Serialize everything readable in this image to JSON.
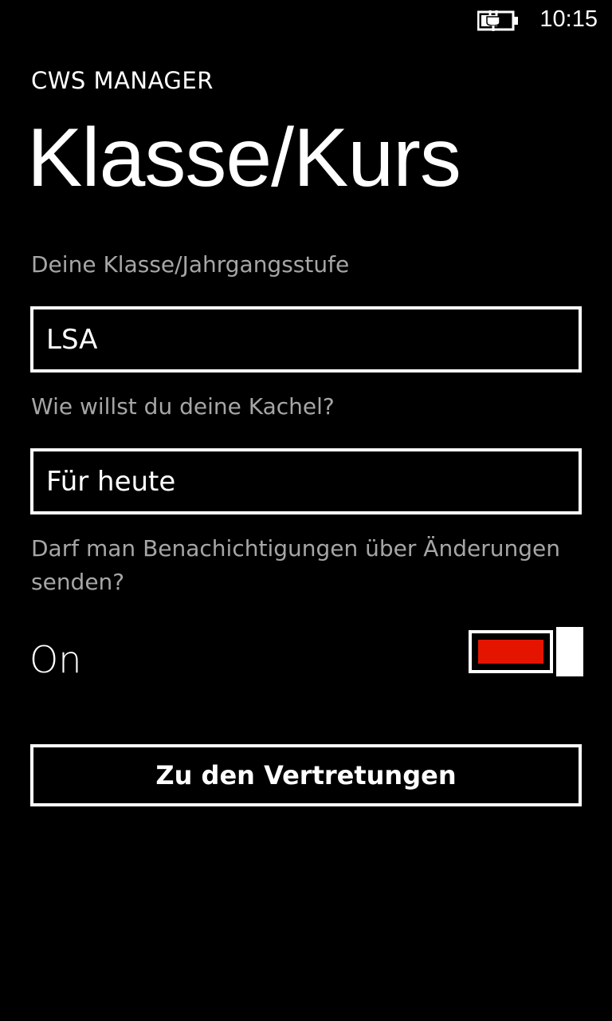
{
  "status_bar": {
    "time": "10:15",
    "battery_icon": "battery-charging-icon"
  },
  "app": {
    "name": "CWS MANAGER",
    "page_title": "Klasse/Kurs"
  },
  "form": {
    "class_label": "Deine Klasse/Jahrgangsstufe",
    "class_value": "LSA",
    "tile_label": "Wie willst du deine Kachel?",
    "tile_value": "Für heute",
    "notifications_label": "Darf man Benachichtigungen über Änderungen senden?",
    "notifications_state": "On",
    "notifications_enabled": true
  },
  "actions": {
    "submit_label": "Zu den Vertretungen"
  },
  "colors": {
    "background": "#000000",
    "foreground": "#ffffff",
    "subtle": "#a6a6a6",
    "accent": "#e51400"
  }
}
